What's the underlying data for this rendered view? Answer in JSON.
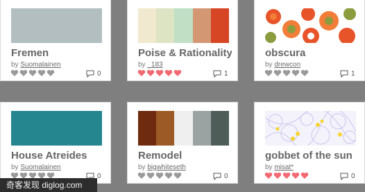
{
  "cards": [
    {
      "title": "Fremen",
      "by": "by",
      "author": "Suomalainen",
      "comment_count": "0",
      "rating_hearts_filled": 0,
      "swatch_colors": [
        "#b2bec0"
      ]
    },
    {
      "title": "Poise & Rationality",
      "by": "by",
      "author": "_183",
      "comment_count": "1",
      "rating_hearts_filled": 5,
      "swatch_colors": [
        "#f1e9cf",
        "#dde4c4",
        "#c0dfc5",
        "#d49773",
        "#d64524"
      ]
    },
    {
      "title": "obscura",
      "by": "by",
      "author": "drewcon",
      "comment_count": "1",
      "rating_hearts_filled": 0,
      "swatch_colors": [
        "#e8542a",
        "#f27d38",
        "#8b9c3f",
        "#ffffff"
      ]
    },
    {
      "title": "House Atreides",
      "by": "by",
      "author": "Suomalainen",
      "comment_count": "0",
      "rating_hearts_filled": 0,
      "swatch_colors": [
        "#26868f"
      ]
    },
    {
      "title": "Remodel",
      "by": "by",
      "author": "bigwhiteseth",
      "comment_count": "0",
      "rating_hearts_filled": 0,
      "swatch_colors": [
        "#6e2b0f",
        "#9c5b26",
        "#efefef",
        "#9aa3a2",
        "#4f5d59"
      ]
    },
    {
      "title": "gobbet of the sun",
      "by": "by",
      "author": "misat*",
      "comment_count": "0",
      "rating_hearts_filled": 5,
      "swatch_colors": [
        "#f4f2fb",
        "#c9c6ee",
        "#f7d330"
      ]
    }
  ],
  "colors": {
    "heart_filled": "#f16a72",
    "heart_empty": "#9a9a9a"
  },
  "watermark": "奇客发现 diglog.com"
}
